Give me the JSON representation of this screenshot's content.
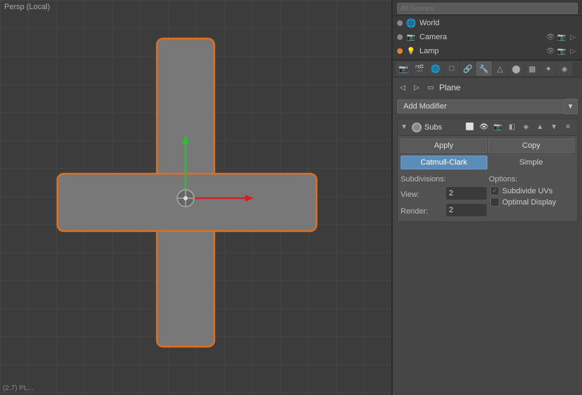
{
  "viewport": {
    "label": "Persp (Local)",
    "bottom_info": "(2.7) PL..."
  },
  "outliner": {
    "search_placeholder": "All Scenes",
    "items": [
      {
        "name": "World",
        "icon": "world",
        "visible": true
      },
      {
        "name": "Camera",
        "icon": "camera",
        "visible": true
      },
      {
        "name": "Lamp",
        "icon": "lamp",
        "visible": true
      }
    ]
  },
  "properties": {
    "object_name": "Plane",
    "tabs": [
      "render",
      "scene",
      "world",
      "object",
      "constraints",
      "modifiers",
      "data",
      "material",
      "texture",
      "particles",
      "physics"
    ]
  },
  "modifier": {
    "name": "Subs",
    "type": "Subdivision Surface",
    "apply_label": "Apply",
    "copy_label": "Copy",
    "tabs": [
      {
        "id": "catmull",
        "label": "Catmull-Clark",
        "active": true
      },
      {
        "id": "simple",
        "label": "Simple",
        "active": false
      }
    ],
    "subdivisions_label": "Subdivisions:",
    "options_label": "Options:",
    "view_label": "View:",
    "view_value": "2",
    "render_label": "Render:",
    "render_value": "2",
    "subdivide_uvs_label": "Subdivide UVs",
    "subdivide_uvs_checked": true,
    "optimal_display_label": "Optimal Display",
    "optimal_display_checked": false
  },
  "add_modifier": {
    "label": "Add Modifier"
  }
}
